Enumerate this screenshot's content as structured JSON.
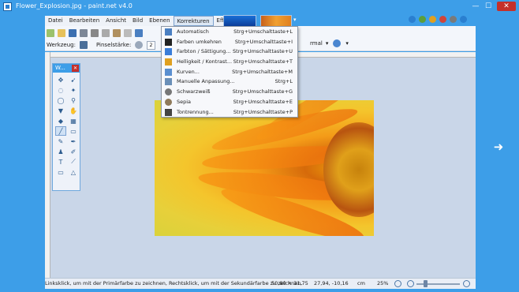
{
  "window": {
    "title": "Flower_Explosion.jpg - paint.net v4.0",
    "minimize": "—",
    "maximize": "☐",
    "close": "✕"
  },
  "menubar": {
    "items": [
      "Datei",
      "Bearbeiten",
      "Ansicht",
      "Bild",
      "Ebenen",
      "Korrekturen",
      "Effekte"
    ],
    "active": "Korrekturen"
  },
  "toolbar": {
    "tool_label": "Werkzeug:",
    "brush_label": "Pinselstärke:",
    "brush_value": "2",
    "blend_value": "rmal"
  },
  "tools_window": {
    "title": "W..."
  },
  "adjustments_menu": {
    "items": [
      {
        "label": "Automatisch",
        "shortcut": "Strg+Umschalttaste+L",
        "icon": "auto-level-icon",
        "color": "#4a7fc1"
      },
      {
        "label": "Farben umkehren",
        "shortcut": "Strg+Umschalttaste+I",
        "icon": "invert-colors-icon",
        "color": "#222222"
      },
      {
        "label": "Farbton / Sättigung...",
        "shortcut": "Strg+Umschalttaste+U",
        "icon": "hue-saturation-icon",
        "color": "#3b7dd8"
      },
      {
        "label": "Helligkeit / Kontrast...",
        "shortcut": "Strg+Umschalttaste+T",
        "icon": "brightness-contrast-icon",
        "color": "#e0a020"
      },
      {
        "label": "Kurven...",
        "shortcut": "Strg+Umschalttaste+M",
        "icon": "curves-icon",
        "color": "#5a8fd0"
      },
      {
        "label": "Manuelle Anpassung...",
        "shortcut": "Strg+L",
        "icon": "levels-icon",
        "color": "#6a8fb8"
      },
      {
        "label": "Schwarzweiß",
        "shortcut": "Strg+Umschalttaste+G",
        "icon": "black-white-icon",
        "color": "#777777"
      },
      {
        "label": "Sepia",
        "shortcut": "Strg+Umschalttaste+E",
        "icon": "sepia-icon",
        "color": "#8f7a5a"
      },
      {
        "label": "Tontrennung...",
        "shortcut": "Strg+Umschalttaste+P",
        "icon": "posterize-icon",
        "color": "#444444"
      }
    ]
  },
  "statusbar": {
    "hint": "Linksklick, um mit der Primärfarbe zu zeichnen, Rechtsklick, um mit der Sekundärfarbe zu zeichnen.",
    "cursor_pos": "50,80 × 31,75",
    "selection_size": "27,94, -10,16",
    "unit": "cm",
    "zoom": "25%"
  },
  "colors": {
    "accent": "#3d9ee8",
    "close": "#c4302b"
  }
}
